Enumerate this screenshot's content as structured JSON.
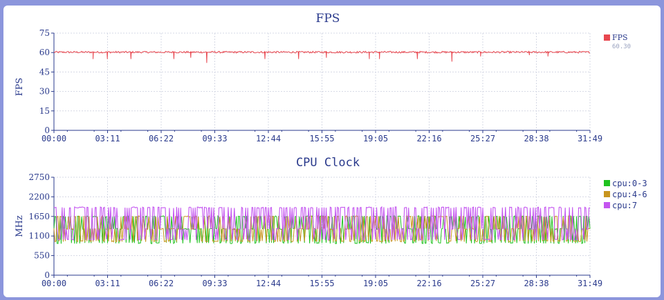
{
  "chart_data": [
    {
      "type": "line",
      "title": "FPS",
      "xlabel": "",
      "ylabel": "FPS",
      "ylim": [
        0,
        75
      ],
      "yticks": [
        "0",
        "15",
        "30",
        "45",
        "60",
        "75"
      ],
      "xticks": [
        "00:00",
        "03:11",
        "06:22",
        "09:33",
        "12:44",
        "15:55",
        "19:05",
        "22:16",
        "25:27",
        "28:38",
        "31:49"
      ],
      "grid": true,
      "legend_position": "right",
      "series": [
        {
          "name": "FPS",
          "color": "#e8474f",
          "summary": "60.30",
          "baseline": 60.3,
          "dips_minutes": [
            2.3,
            3.15,
            4.55,
            7.1,
            8.1,
            9.05,
            12.5,
            14.5,
            16.15,
            18.7,
            19.3,
            21.55,
            23.6,
            25.3,
            28.2,
            29.3
          ],
          "dips_values": [
            55,
            55,
            55,
            55,
            56,
            52,
            55,
            55,
            56,
            55,
            55,
            55,
            53,
            57,
            58,
            57
          ]
        }
      ]
    },
    {
      "type": "line",
      "title": "CPU Clock",
      "xlabel": "",
      "ylabel": "MHz",
      "ylim": [
        0,
        2750
      ],
      "yticks": [
        "0",
        "550",
        "1100",
        "1650",
        "2200",
        "2750"
      ],
      "xticks": [
        "00:00",
        "03:11",
        "06:22",
        "09:33",
        "12:44",
        "15:55",
        "19:05",
        "22:16",
        "25:27",
        "28:38",
        "31:49"
      ],
      "grid": true,
      "legend_position": "right",
      "series": [
        {
          "name": "cpu:0-3",
          "color": "#1fc21f",
          "levels_mhz": [
            900,
            1300,
            1650
          ]
        },
        {
          "name": "cpu:4-6",
          "color": "#c8951e",
          "levels_mhz": [
            950,
            1300,
            1650
          ]
        },
        {
          "name": "cpu:7",
          "color": "#c455f0",
          "levels_mhz": [
            1000,
            1300,
            1900
          ]
        }
      ]
    }
  ]
}
